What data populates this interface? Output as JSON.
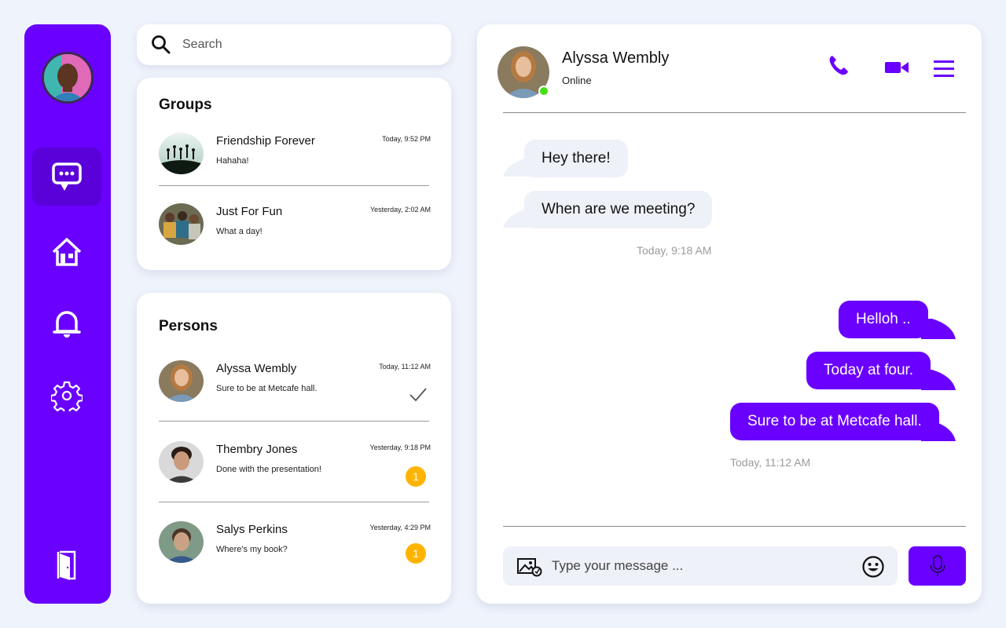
{
  "sidebar": {
    "nav": [
      "chat-icon",
      "home-icon",
      "bell-icon",
      "gear-icon"
    ],
    "active": "chat-icon",
    "logout": "door-icon"
  },
  "search": {
    "placeholder": "Search"
  },
  "groups": {
    "title": "Groups",
    "items": [
      {
        "name": "Friendship Forever",
        "message": "Hahaha!",
        "time": "Today, 9:52 PM"
      },
      {
        "name": "Just For Fun",
        "message": "What a day!",
        "time": "Yesterday, 2:02 AM"
      }
    ]
  },
  "persons": {
    "title": "Persons",
    "items": [
      {
        "name": "Alyssa Wembly",
        "message": "Sure to be at Metcafe hall.",
        "time": "Today, 11:12 AM",
        "status": "read"
      },
      {
        "name": "Thembry Jones",
        "message": "Done with the presentation!",
        "time": "Yesterday, 9:18 PM",
        "unread": "1"
      },
      {
        "name": "Salys Perkins",
        "message": "Where's my book?",
        "time": "Yesterday, 4:29 PM",
        "unread": "1"
      }
    ]
  },
  "chat": {
    "contact": {
      "name": "Alyssa Wembly",
      "status": "Online"
    },
    "header_icons": [
      "phone-icon",
      "video-icon",
      "menu-icon"
    ],
    "messages": [
      {
        "direction": "in",
        "text": "Hey there!"
      },
      {
        "direction": "in",
        "text": "When are we meeting?"
      },
      {
        "direction": "out",
        "text": "Helloh .."
      },
      {
        "direction": "out",
        "text": "Today at four."
      },
      {
        "direction": "out",
        "text": "Sure to be at Metcafe hall."
      }
    ],
    "timestamps": [
      "Today, 9:18 AM",
      "Today, 11:12 AM"
    ],
    "composer": {
      "placeholder": "Type your message ..."
    }
  },
  "colors": {
    "accent": "#6a00ff",
    "background": "#eff3fb",
    "badge": "#ffb400",
    "online": "#44e017"
  }
}
